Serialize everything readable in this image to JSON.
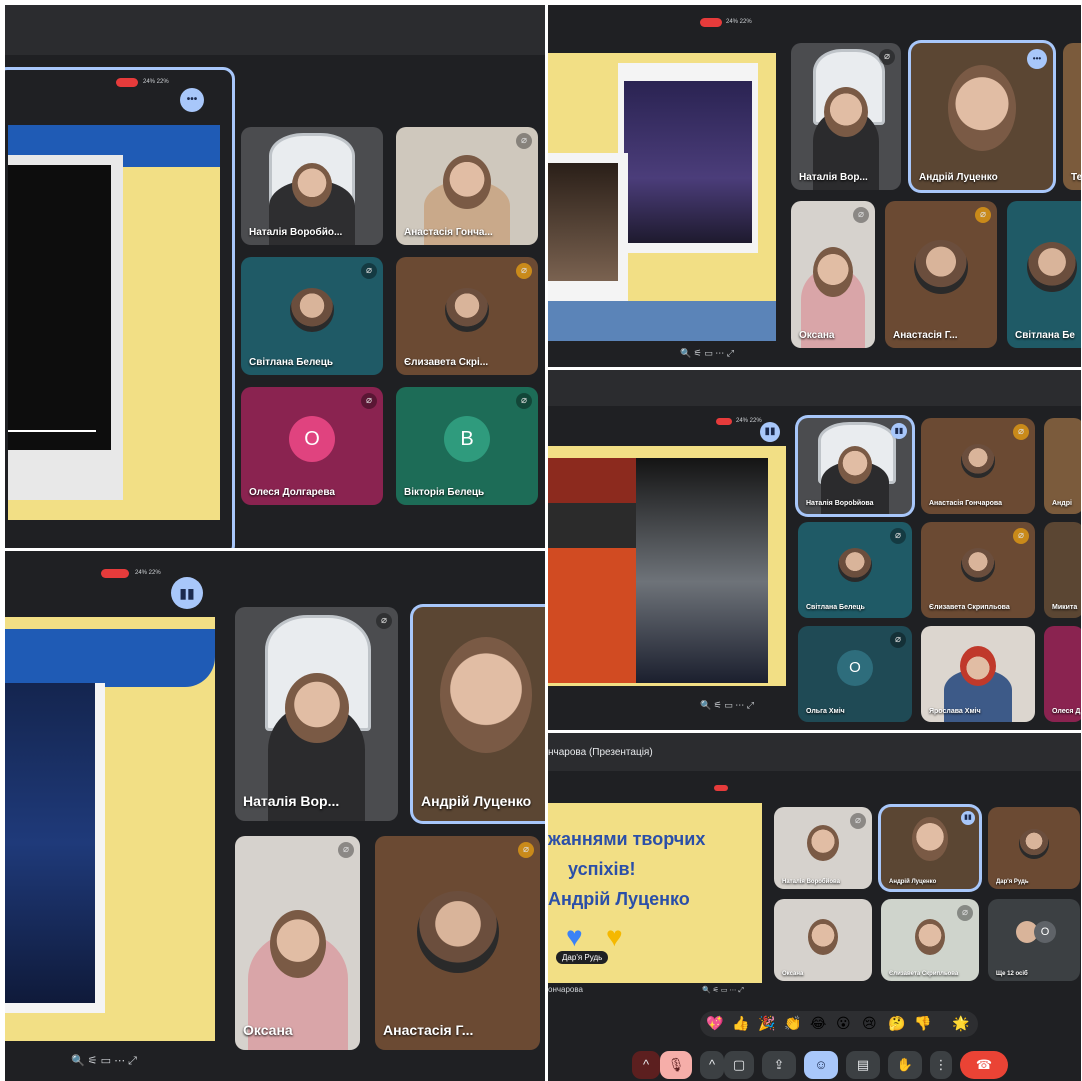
{
  "recording_status": "24% 22%",
  "panel1": {
    "tiles": [
      {
        "name": "Наталія Воробйо..."
      },
      {
        "name": "Анастасія Гонча..."
      },
      {
        "name": "Світлана Белець"
      },
      {
        "name": "Єлизавета Скрі..."
      },
      {
        "name": "Олеся Долгарева",
        "initial": "О"
      },
      {
        "name": "Вікторія Белець",
        "initial": "В"
      }
    ]
  },
  "panel2": {
    "tiles": [
      {
        "name": "Наталія Вор..."
      },
      {
        "name": "Андрій Луценко"
      },
      {
        "name": "Те"
      },
      {
        "name": "Оксана"
      },
      {
        "name": "Анастасія Г..."
      },
      {
        "name": "Світлана Бе"
      }
    ]
  },
  "panel3": {
    "tiles": [
      {
        "name": "Наталія Ворobйова"
      },
      {
        "name": "Анастасія Гончарова"
      },
      {
        "name": "Андрі"
      },
      {
        "name": "Світлана Белець"
      },
      {
        "name": "Єлизавета Скрипльова"
      },
      {
        "name": "Микита"
      },
      {
        "name": "Ольга Хміч",
        "initial": "О"
      },
      {
        "name": "Ярослава Хміч"
      },
      {
        "name": "Олеся Д"
      }
    ]
  },
  "panel4": {
    "tiles": [
      {
        "name": "Наталія Вор..."
      },
      {
        "name": "Андрій Луценко"
      },
      {
        "name": "Оксана"
      },
      {
        "name": "Анастасія Г..."
      }
    ]
  },
  "panel5": {
    "header": "нчарова (Презентація)",
    "slide_lines": [
      "жаннями творчих",
      "успіхів!",
      "Андрій Луценко"
    ],
    "reaction_label": "Дар'я Рудь",
    "presenter_caption": "ончарова",
    "tiles": [
      {
        "name": "Наталія Воробйова"
      },
      {
        "name": "Андрій Луценко"
      },
      {
        "name": "Дар'я Рудь"
      },
      {
        "name": "Оксана"
      },
      {
        "name": "Єлизавета Скрипльова"
      },
      {
        "name": "Ще 12 осіб"
      }
    ],
    "emojis": [
      "💖",
      "👍",
      "🎉",
      "👏",
      "😂",
      "😮",
      "😢",
      "🤔",
      "👎",
      "🌟"
    ],
    "controls": [
      "^",
      "🎙",
      "^",
      "▢",
      "⇪",
      "☺",
      "▤",
      "✋",
      "⋮",
      "☎"
    ]
  },
  "colors": {
    "meet_bg": "#1f2023",
    "accent": "#a8c7fa",
    "slide_yellow": "#f2df85",
    "slide_blue": "#1f5bb5",
    "end_call": "#ea4335"
  }
}
